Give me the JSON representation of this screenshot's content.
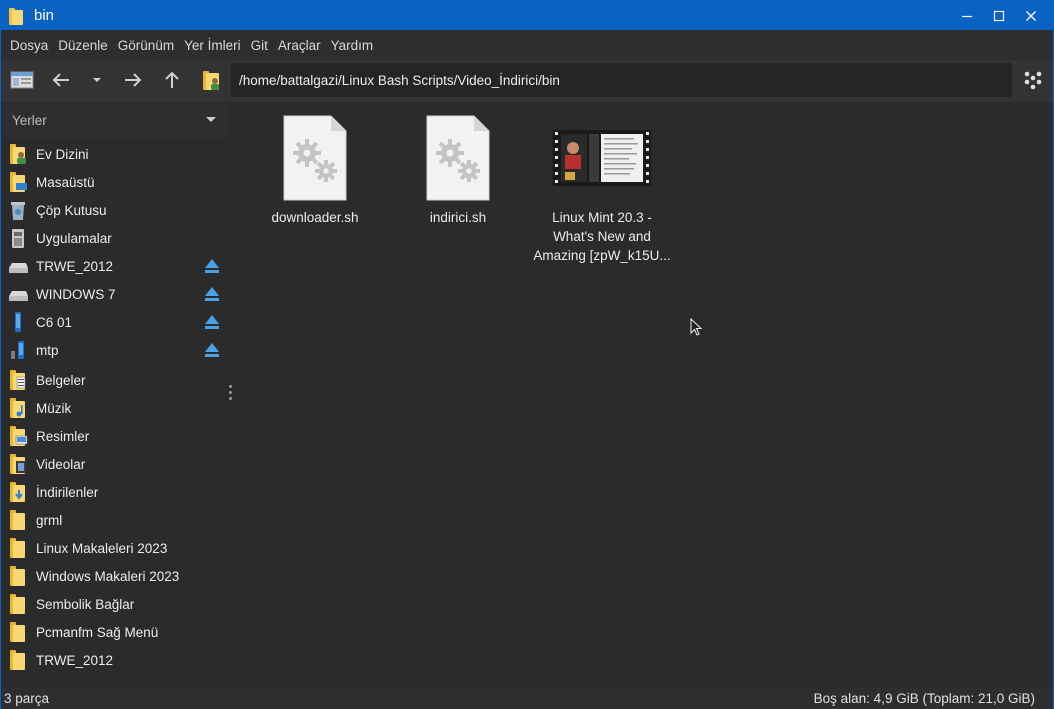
{
  "window": {
    "title": "bin",
    "accent": "#0a63c4"
  },
  "menu": [
    "Dosya",
    "Düzenle",
    "Görünüm",
    "Yer İmleri",
    "Git",
    "Araçlar",
    "Yardım"
  ],
  "toolbar": {
    "path": "/home/battalgazi/Linux Bash Scripts/Video_İndirici/bin",
    "icons": [
      "new-window-icon",
      "back-arrow-icon",
      "history-dropdown-icon",
      "forward-arrow-icon",
      "up-arrow-icon",
      "home-folder-icon",
      "menu-icon"
    ]
  },
  "sidebar": {
    "header": "Yerler",
    "places": [
      {
        "label": "Ev Dizini",
        "icon": "home-folder-icon"
      },
      {
        "label": "Masaüstü",
        "icon": "desktop-folder-icon"
      },
      {
        "label": "Çöp Kutusu",
        "icon": "trash-icon"
      },
      {
        "label": "Uygulamalar",
        "icon": "applications-icon"
      }
    ],
    "devices": [
      {
        "label": "TRWE_2012",
        "icon": "drive-icon"
      },
      {
        "label": "WINDOWS 7",
        "icon": "drive-icon"
      },
      {
        "label": "C6 01",
        "icon": "phone-icon"
      },
      {
        "label": "mtp",
        "icon": "phone-icon"
      }
    ],
    "bookmarks": [
      {
        "label": "Belgeler",
        "icon": "documents-folder-icon"
      },
      {
        "label": "Müzik",
        "icon": "music-folder-icon"
      },
      {
        "label": "Resimler",
        "icon": "pictures-folder-icon"
      },
      {
        "label": "Videolar",
        "icon": "videos-folder-icon"
      },
      {
        "label": "İndirilenler",
        "icon": "downloads-folder-icon"
      },
      {
        "label": "grml",
        "icon": "folder-icon"
      },
      {
        "label": "Linux Makaleleri 2023",
        "icon": "folder-icon"
      },
      {
        "label": "Windows Makaleri 2023",
        "icon": "folder-icon"
      },
      {
        "label": "Sembolik Bağlar",
        "icon": "folder-icon"
      },
      {
        "label": "Pcmanfm Sağ Menü",
        "icon": "folder-icon"
      },
      {
        "label": "TRWE_2012",
        "icon": "folder-icon"
      }
    ]
  },
  "files": [
    {
      "name": "downloader.sh",
      "type": "script"
    },
    {
      "name": "indirici.sh",
      "type": "script"
    },
    {
      "name": "Linux Mint 20.3 - What's New and Amazing [zpW_k15U...",
      "type": "video"
    }
  ],
  "status": {
    "items": "3 parça",
    "free": "Boş alan: 4,9 GiB (Toplam: 21,0 GiB)"
  }
}
